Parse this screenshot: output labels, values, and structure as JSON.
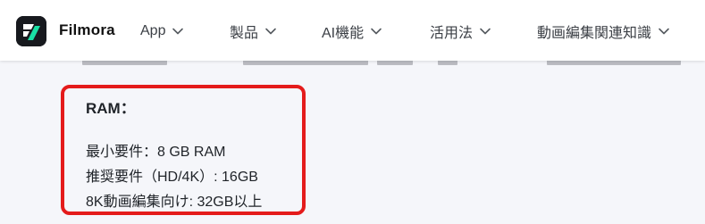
{
  "navbar": {
    "brand": "Filmora",
    "items": [
      {
        "label": "App"
      },
      {
        "label": "製品"
      },
      {
        "label": "AI機能"
      },
      {
        "label": "活用法"
      },
      {
        "label": "動画編集関連知識"
      }
    ]
  },
  "article": {
    "ram_heading": "RAM：",
    "specs": [
      {
        "text": "最小要件：8 GB RAM"
      },
      {
        "text": "推奨要件（HD/4K）: 16GB"
      },
      {
        "text": "8K動画編集向け: 32GB以上"
      }
    ]
  },
  "colors": {
    "highlight_border": "#e41b1b",
    "logo_green": "#19e0a4",
    "page_background": "#f5f6fa"
  },
  "icons": {
    "logo": "filmora-logo-icon",
    "dropdown": "chevron-down-icon"
  }
}
